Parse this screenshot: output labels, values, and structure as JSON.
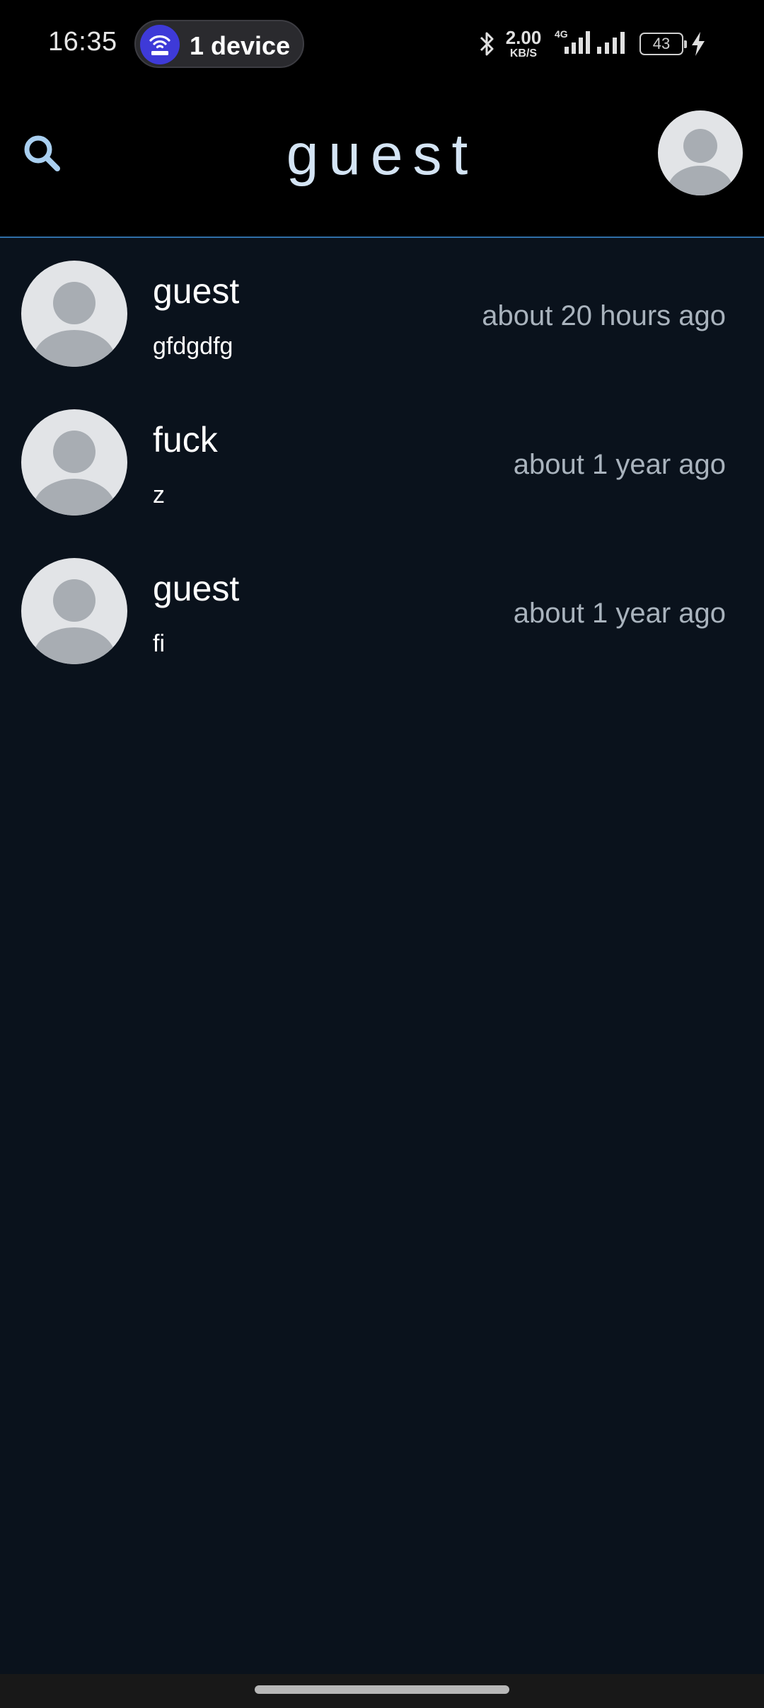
{
  "status_bar": {
    "time": "16:35",
    "device_pill": {
      "label": "1 device",
      "icon": "wifi-hotspot-icon"
    },
    "net_speed": {
      "value": "2.00",
      "unit": "KB/S"
    },
    "network_type": "4G",
    "battery_level": "43",
    "icons": [
      "bluetooth-icon",
      "signal-4g-icon",
      "signal-icon",
      "battery-icon",
      "charging-icon"
    ]
  },
  "app_bar": {
    "title": "guest",
    "search_icon": "search-icon",
    "avatar_icon": "person-icon"
  },
  "conversations": [
    {
      "name": "guest",
      "preview": "gfdgdfg",
      "time": "about 20 hours ago"
    },
    {
      "name": "fuck",
      "preview": "z",
      "time": "about 1 year ago"
    },
    {
      "name": "guest",
      "preview": "fi",
      "time": "about 1 year ago"
    }
  ],
  "colors": {
    "background": "#0a121c",
    "app_bar": "#000000",
    "accent_line": "#2f6fa8",
    "title": "#d4e4f4",
    "search_icon": "#a9cff0",
    "timestamp": "#a9b3bd",
    "avatar_bg": "#e2e4e7",
    "avatar_fg": "#a8adb3",
    "device_badge": "#3e3ad8"
  }
}
